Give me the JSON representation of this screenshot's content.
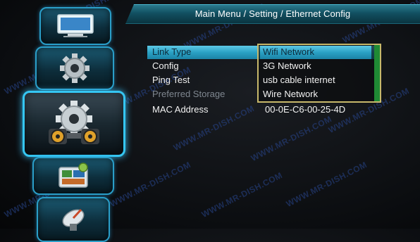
{
  "header": {
    "title": "Main Menu / Setting / Ethernet Config"
  },
  "watermark": "WWW.MR-DISH.COM",
  "menu_icons": [
    {
      "name": "tv-screen-icon"
    },
    {
      "name": "gear-icon"
    },
    {
      "name": "satellite-gear-icon",
      "selected": true
    },
    {
      "name": "media-icon"
    },
    {
      "name": "satellite-dish-icon"
    }
  ],
  "settings": [
    {
      "label": "Link Type",
      "value": "Wifi Network"
    },
    {
      "label": "Config",
      "value": "3G Network"
    },
    {
      "label": "Ping Test",
      "value": "usb cable internet"
    },
    {
      "label": "Preferred Storage",
      "value": "Wire Network"
    },
    {
      "label": "MAC Address",
      "value": "00-0E-C6-00-25-4D"
    }
  ],
  "dropdown": {
    "options": [
      "Wifi Network",
      "3G Network",
      "usb cable internet",
      "Wire Network"
    ],
    "selected": "Wifi Network"
  },
  "colors": {
    "accent": "#35c6f2",
    "highlight": "#2aa1c4",
    "dropdown_border": "#c7b86a",
    "scrollbar": "#1f8a34"
  }
}
